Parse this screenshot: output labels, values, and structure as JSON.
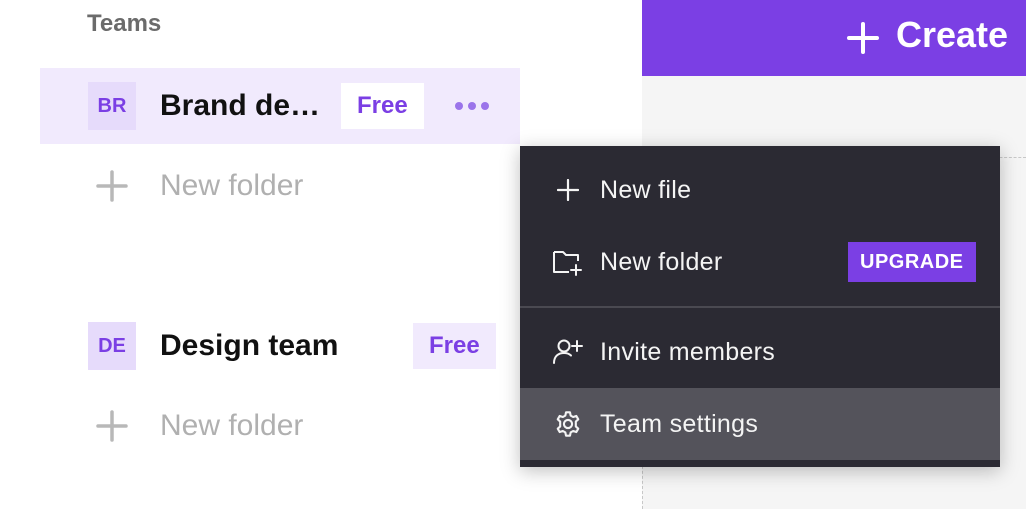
{
  "sidebar": {
    "section_label": "Teams",
    "teams": [
      {
        "initials": "BR",
        "name": "Brand de…",
        "plan": "Free",
        "active": true
      },
      {
        "initials": "DE",
        "name": "Design team",
        "plan": "Free",
        "active": false
      }
    ],
    "new_folder_label": "New folder"
  },
  "header": {
    "create_label": "Create"
  },
  "context_menu": {
    "items": [
      {
        "label": "New file",
        "icon": "plus-icon"
      },
      {
        "label": "New folder",
        "icon": "folder-plus-icon",
        "badge": "UPGRADE"
      },
      {
        "label": "Invite members",
        "icon": "user-plus-icon"
      },
      {
        "label": "Team settings",
        "icon": "gear-icon",
        "highlighted": true
      }
    ]
  },
  "colors": {
    "accent": "#7b3fe4",
    "menu_bg": "#2b2a33",
    "menu_hover": "#54535b",
    "active_row": "#f1eafd"
  }
}
